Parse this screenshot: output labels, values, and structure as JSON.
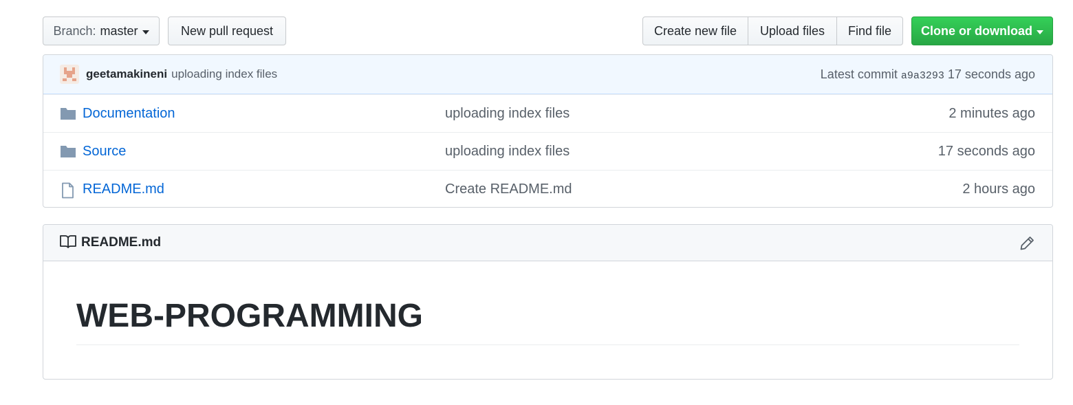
{
  "toolbar": {
    "branch_prefix": "Branch:",
    "branch_name": "master",
    "new_pull_request": "New pull request",
    "create_new_file": "Create new file",
    "upload_files": "Upload files",
    "find_file": "Find file",
    "clone_or_download": "Clone or download"
  },
  "commit": {
    "author": "geetamakineni",
    "message": "uploading index files",
    "latest_label": "Latest commit",
    "sha": "a9a3293",
    "age": "17 seconds ago"
  },
  "files": [
    {
      "name": "Documentation",
      "type": "folder",
      "message": "uploading index files",
      "age": "2 minutes ago"
    },
    {
      "name": "Source",
      "type": "folder",
      "message": "uploading index files",
      "age": "17 seconds ago"
    },
    {
      "name": "README.md",
      "type": "file",
      "message": "Create README.md",
      "age": "2 hours ago"
    }
  ],
  "readme": {
    "filename": "README.md",
    "heading": "WEB-PROGRAMMING"
  },
  "icons": {
    "folder": "folder-icon",
    "file": "file-icon",
    "book": "book-icon",
    "edit": "pencil-icon"
  },
  "colors": {
    "link": "#0366d6",
    "clone_button": "#28a745",
    "commit_bar": "#f1f8ff",
    "folder_icon": "#79b8ff"
  }
}
